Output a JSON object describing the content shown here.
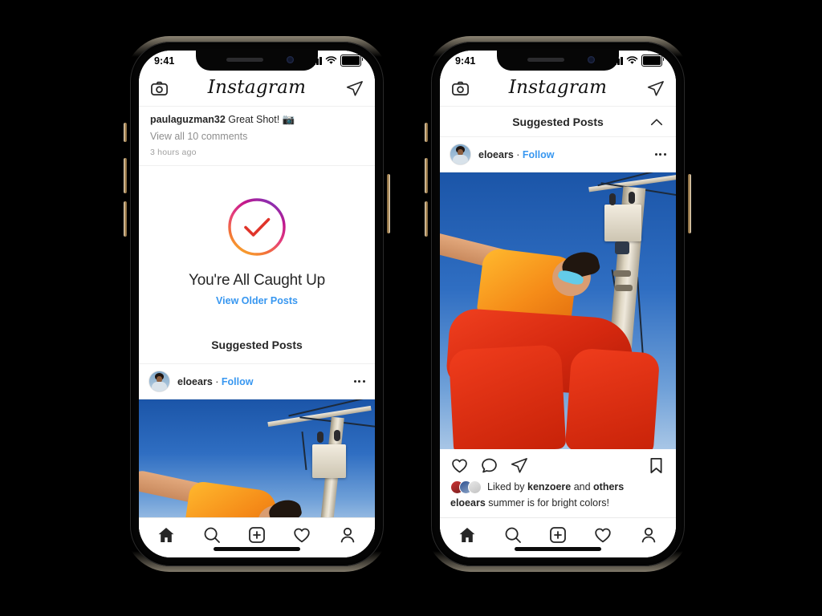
{
  "status_bar": {
    "time": "9:41",
    "signal_icon": "cellular-bars-icon",
    "wifi_icon": "wifi-icon",
    "battery_icon": "battery-full-icon"
  },
  "nav": {
    "camera_icon": "camera-icon",
    "logo": "Instagram",
    "direct_icon": "paper-plane-icon"
  },
  "left_phone": {
    "feed_tail": {
      "caption_user": "paulaguzman32",
      "caption_text": " Great Shot! 📷",
      "comments_link": "View all 10 comments",
      "timestamp": "3 hours ago"
    },
    "caught_up": {
      "check_icon": "check-circle-gradient-icon",
      "title": "You're All Caught Up",
      "link": "View Older Posts"
    },
    "suggested_heading": "Suggested Posts",
    "post": {
      "avatar": "user-avatar",
      "username": "eloears",
      "separator": " · ",
      "follow_label": "Follow",
      "more_icon": "more-options-icon"
    }
  },
  "right_phone": {
    "suggested_bar": {
      "title": "Suggested Posts",
      "collapse_icon": "chevron-up-icon"
    },
    "post": {
      "avatar": "user-avatar",
      "username": "eloears",
      "separator": " · ",
      "follow_label": "Follow",
      "more_icon": "more-options-icon"
    },
    "actions": {
      "like_icon": "heart-icon",
      "comment_icon": "comment-bubble-icon",
      "share_icon": "paper-plane-icon",
      "save_icon": "bookmark-icon"
    },
    "likes": {
      "prefix": "Liked by ",
      "name": "kenzoere",
      "middle": " and ",
      "suffix": "others"
    },
    "caption": {
      "user": "eloears",
      "text": " summer is for bright colors!"
    }
  },
  "tabbar": {
    "home_icon": "home-icon",
    "search_icon": "search-icon",
    "add_icon": "plus-square-icon",
    "activity_icon": "heart-icon",
    "profile_icon": "person-icon"
  },
  "colors": {
    "accent_blue": "#3897f0",
    "text_primary": "#262626",
    "text_muted": "#8e8e8e",
    "gradient_start": "#b5249a",
    "gradient_end": "#f59038",
    "check_red": "#e0342a"
  }
}
